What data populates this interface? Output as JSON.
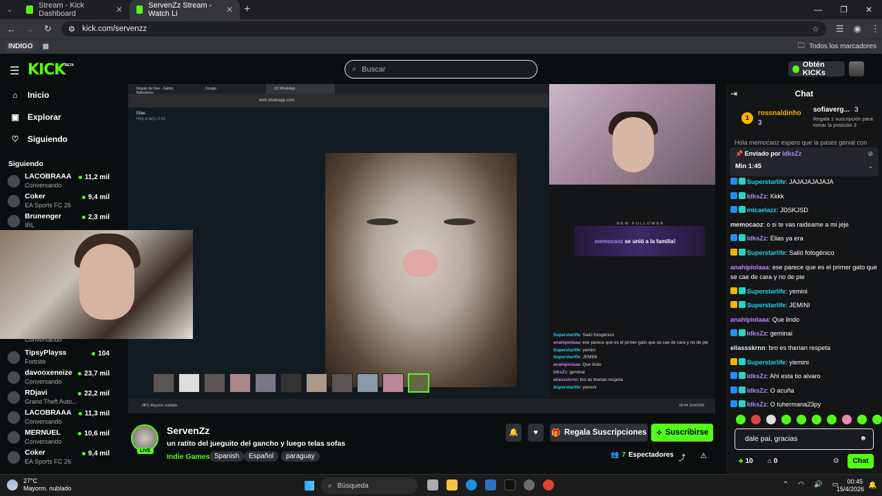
{
  "browser": {
    "tabs": [
      {
        "label": "Stream - Kick Dashboard"
      },
      {
        "label": "ServenZz Stream - Watch Li"
      }
    ],
    "url": "kick.com/servenzz",
    "bookmarks": {
      "indigo": "INDIGO",
      "all": "Todos los marcadores"
    }
  },
  "header": {
    "logo": "KICK",
    "beta": "BETA",
    "search_placeholder": "Buscar",
    "get_kicks": "Obtén KICKs"
  },
  "sidebar": {
    "nav": [
      {
        "label": "Inicio"
      },
      {
        "label": "Explorar"
      },
      {
        "label": "Siguiendo"
      }
    ],
    "following_title": "Siguiendo",
    "channels_top": [
      {
        "name": "LACOBRAAA",
        "category": "Conversando",
        "viewers": "11,2 mil"
      },
      {
        "name": "Coker",
        "category": "EA Sports FC 26",
        "viewers": "9,4 mil"
      },
      {
        "name": "Brunenger",
        "category": "IRL",
        "viewers": "2,3 mil"
      }
    ],
    "channels_bottom_cut": "Conversando",
    "channels_bottom": [
      {
        "name": "TipsyPlayss",
        "category": "Fortnite",
        "viewers": "104"
      },
      {
        "name": "davooxeneize",
        "category": "Conversando",
        "viewers": "23,7 mil"
      },
      {
        "name": "RDjavi",
        "category": "Grand Theft Auto...",
        "viewers": "22,2 mil"
      },
      {
        "name": "LACOBRAAA",
        "category": "Conversando",
        "viewers": "11,3 mil"
      },
      {
        "name": "MERNUEL",
        "category": "Conversando",
        "viewers": "10,6 mil"
      },
      {
        "name": "Coker",
        "category": "EA Sports FC 26",
        "viewers": "9,4 mil"
      }
    ]
  },
  "stream_overlay": {
    "inner_tabs": [
      "Regalo de Dios - Gabito Ballesteros",
      "Google",
      "(2) WhatsApp"
    ],
    "inner_url": "web.whatsapp.com",
    "wa_contact": "Elias",
    "wa_time": "Hoy a la(s) 0:42",
    "new_follower_label": "NEW FOLLOWER",
    "new_follower_user": "memocaoz",
    "new_follower_text": " se unió a la familia!",
    "mini_chat": [
      {
        "user": "Superstarlife",
        "text": ": Salió fotogénico"
      },
      {
        "user": "anahipiolaaa",
        "text": ": ese parece que es el primer gato que se cae de cara y no de pie"
      },
      {
        "user": "Superstarlife",
        "text": ": yemini"
      },
      {
        "user": "Superstarlife",
        "text": ": JEMINI"
      },
      {
        "user": "anahipiolaaa",
        "text": ": Que lindo"
      },
      {
        "user": "IdksZz",
        "text": ": geminai"
      },
      {
        "user": "eliassskrnn",
        "text": ": bro es therian respeta"
      },
      {
        "user": "Superstarlife",
        "text": ": yiemini"
      }
    ],
    "inner_weather": "28°C Mayorm. nublado",
    "inner_clock": "00:44 15/4/2026"
  },
  "streamer": {
    "name": "ServenZz",
    "live": "LIVE",
    "title": "un ratito del jueguito del gancho y luego telas sofas",
    "category": "Indie Games",
    "tags": [
      "Spanish",
      "Español",
      "paraguay"
    ],
    "gift_button": "Regala Suscripciones",
    "subscribe_button": "Suscribirse",
    "viewers_count": "7",
    "viewers_label": "Espectadores"
  },
  "chat": {
    "title": "Chat",
    "gifters": [
      {
        "rank": "1",
        "name": "rossnaldinho",
        "count": "3"
      },
      {
        "name": "sofiaverg...",
        "count": "3",
        "desc": "Regala 1 suscripción para tomar la posición 3"
      }
    ],
    "cut_line": "Hola memocaoz espero que la pases genial con",
    "pinned": {
      "label": "Enviado por",
      "user": "IdksZz",
      "time": "Min 1:45"
    },
    "messages": [
      {
        "user": "Superstarlife",
        "text": ": JAJAJAJAJAJA",
        "color": "#22d3ee",
        "badge": "b"
      },
      {
        "user": "IdksZz",
        "text": ": Kkkk",
        "color": "#a78bfa",
        "badge": "b"
      },
      {
        "user": "micaelazz",
        "text": ": JDSKJSD",
        "color": "#22d3ee",
        "badge": "b"
      },
      {
        "user": "memocaoz",
        "text": ": o si te vas raideame a mi jeje",
        "color": "#e8eaed",
        "badge": ""
      },
      {
        "user": "IdksZz",
        "text": ": Elias ya era",
        "color": "#a78bfa",
        "badge": "b"
      },
      {
        "user": "Superstarlife",
        "text": ": Salió fotogénico",
        "color": "#22d3ee",
        "badge": "c"
      },
      {
        "user": "anahipiolaaa",
        "text": ": ese parece que es el primer gato que se cae de cara y no de pie",
        "color": "#c084fc",
        "badge": "",
        "two": true
      },
      {
        "user": "Superstarlife",
        "text": ": yemini",
        "color": "#22d3ee",
        "badge": "c"
      },
      {
        "user": "Superstarlife",
        "text": ": JEMINI",
        "color": "#22d3ee",
        "badge": "c"
      },
      {
        "user": "anahipiolaaa",
        "text": ": Que lindo",
        "color": "#c084fc",
        "badge": ""
      },
      {
        "user": "IdksZz",
        "text": ": geminai",
        "color": "#a78bfa",
        "badge": "b"
      },
      {
        "user": "eliassskrnn",
        "text": ": bro es therian respeta",
        "color": "#e8eaed",
        "badge": ""
      },
      {
        "user": "Superstarlife",
        "text": ": yiemini",
        "color": "#22d3ee",
        "badge": "c"
      },
      {
        "user": "IdksZz",
        "text": ": Ahí esta tio alvaro",
        "color": "#a78bfa",
        "badge": "b"
      },
      {
        "user": "IdksZz",
        "text": ": O acuña",
        "color": "#a78bfa",
        "badge": "b"
      },
      {
        "user": "IdksZz",
        "text": ": O tuhermana23py",
        "color": "#a78bfa",
        "badge": "b"
      }
    ],
    "input_value": "dale pai, gracias",
    "points": "10",
    "tokens": "0",
    "send_button": "Chat"
  },
  "taskbar": {
    "weather_temp": "27°C",
    "weather_desc": "Mayorm. nublado",
    "search": "Búsqueda",
    "time": "00:45",
    "date": "15/4/2026"
  },
  "colors": {
    "kick_green": "#53fc18",
    "background": "#0b0e0f",
    "chat_bg": "#141517"
  }
}
